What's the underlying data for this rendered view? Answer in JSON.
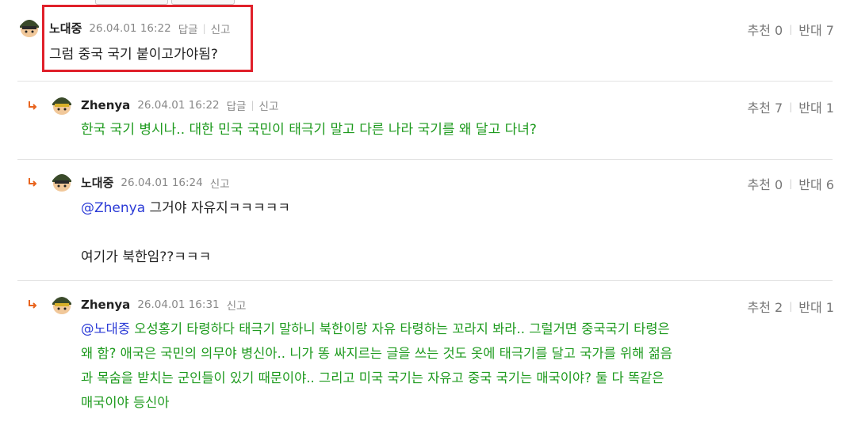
{
  "comments": [
    {
      "author": "노대중",
      "date": "26.04.01 16:22",
      "reply_label": "답글",
      "report_label": "신고",
      "recommend_label": "추천 0",
      "oppose_label": "반대 7",
      "lines": [
        "그럼 중국 국기 붙이고가야됨?"
      ]
    },
    {
      "author": "Zhenya",
      "date": "26.04.01 16:22",
      "reply_label": "답글",
      "report_label": "신고",
      "recommend_label": "추천 7",
      "oppose_label": "반대 1",
      "lines": [
        "한국 국기 병시나.. 대한 민국 국민이 태극기 말고 다른 나라 국기를 왜 달고 다녀?"
      ]
    },
    {
      "author": "노대중",
      "date": "26.04.01 16:24",
      "report_label": "신고",
      "recommend_label": "추천 0",
      "oppose_label": "반대 6",
      "mention": "@Zhenya",
      "line1_rest": " 그거야 자유지ㅋㅋㅋㅋㅋ",
      "line2": "여기가 북한임??ㅋㅋㅋ"
    },
    {
      "author": "Zhenya",
      "date": "26.04.01 16:31",
      "report_label": "신고",
      "recommend_label": "추천 2",
      "oppose_label": "반대 1",
      "mention": "@노대중",
      "line1_rest": " 오성홍기 타령하다 태극기 말하니 북한이랑 자유 타령하는 꼬라지 봐라.. 그럴거면 중국국기 타령은",
      "line2": "왜 함? 애국은 국민의 의무야 병신아.. 니가 똥 싸지르는 글을 쓰는 것도 옷에 태극기를 달고 국가를 위해 젊음",
      "line3": "과 목숨을 받치는 군인들이 있기 때문이야.. 그리고 미국 국기는 자유고 중국 국기는 매국이야? 둘 다 똑같은",
      "line4": "매국이야 등신아"
    }
  ],
  "colors": {
    "reply_text": "#1d9a1d",
    "mention": "#2a3ad6",
    "highlight": "#e0202a",
    "arrow": "#e8641e"
  },
  "icons": {
    "avatar": "helmet-avatar-icon",
    "reply_arrow": "reply-arrow-icon"
  }
}
